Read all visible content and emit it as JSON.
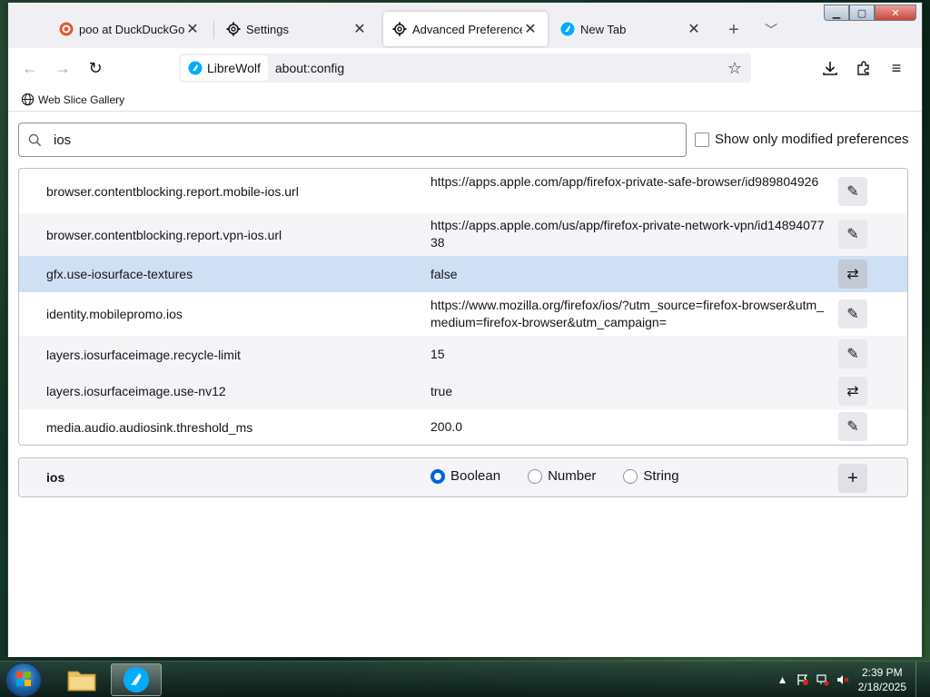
{
  "browser": {
    "tabs": [
      {
        "label": "poo at DuckDuckGo",
        "icon": "duckduckgo-icon",
        "active": false
      },
      {
        "label": "Settings",
        "icon": "gear-icon",
        "active": false
      },
      {
        "label": "Advanced Preferences",
        "icon": "gear-icon",
        "active": true
      },
      {
        "label": "New Tab",
        "icon": "librewolf-icon",
        "active": false
      }
    ],
    "identity_label": "LibreWolf",
    "url": "about:config",
    "bookmark": "Web Slice Gallery"
  },
  "config": {
    "search_value": "ios",
    "modified_label": "Show only modified preferences",
    "prefs": [
      {
        "name": "browser.contentblocking.report.mobile-ios.url",
        "value": "https://apps.apple.com/app/firefox-private-safe-browser/id989804926",
        "action": "edit"
      },
      {
        "name": "browser.contentblocking.report.vpn-ios.url",
        "value": "https://apps.apple.com/us/app/firefox-private-network-vpn/id1489407738",
        "action": "edit"
      },
      {
        "name": "gfx.use-iosurface-textures",
        "value": "false",
        "action": "toggle"
      },
      {
        "name": "identity.mobilepromo.ios",
        "value": "https://www.mozilla.org/firefox/ios/?utm_source=firefox-browser&utm_medium=firefox-browser&utm_campaign=",
        "action": "edit"
      },
      {
        "name": "layers.iosurfaceimage.recycle-limit",
        "value": "15",
        "action": "edit"
      },
      {
        "name": "layers.iosurfaceimage.use-nv12",
        "value": "true",
        "action": "toggle"
      },
      {
        "name": "media.audio.audiosink.threshold_ms",
        "value": "200.0",
        "action": "edit"
      }
    ],
    "new_pref": {
      "name": "ios",
      "types": [
        "Boolean",
        "Number",
        "String"
      ],
      "selected": "Boolean"
    }
  },
  "taskbar": {
    "time": "2:39 PM",
    "date": "2/18/2025"
  },
  "colors": {
    "accent": "#0061e0",
    "selected_row": "#cfe0f5"
  }
}
